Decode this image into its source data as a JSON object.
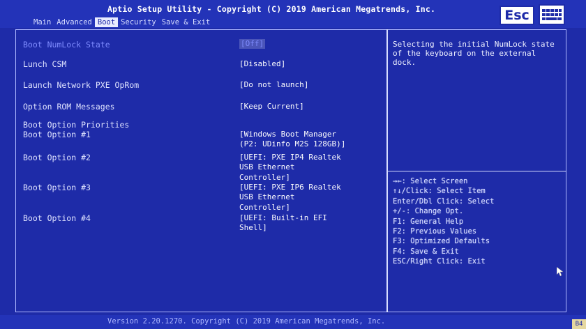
{
  "title": "Aptio Setup Utility - Copyright (C) 2019 American Megatrends, Inc.",
  "tabs": [
    {
      "label": "Main",
      "active": false
    },
    {
      "label": "Advanced",
      "active": false
    },
    {
      "label": "Boot",
      "active": true
    },
    {
      "label": "Security",
      "active": false
    },
    {
      "label": "Save & Exit",
      "active": false
    }
  ],
  "esc_label": "Esc",
  "icons": {
    "keyboard": "keyboard-icon",
    "cursor": "mouse-pointer-icon"
  },
  "settings": [
    {
      "label": "Boot NumLock State",
      "value": "[Off]",
      "selected": true
    },
    {
      "label": "Lunch CSM",
      "value": "[Disabled]",
      "selected": false
    },
    {
      "label": "Launch Network PXE OpRom",
      "value": "[Do not launch]",
      "selected": false
    },
    {
      "label": "Option ROM Messages",
      "value": "[Keep Current]",
      "selected": false
    }
  ],
  "section_header": "Boot Option Priorities",
  "boot_options": [
    {
      "label": "Boot Option #1",
      "value_lines": [
        "[Windows Boot Manager",
        "(P2: UDinfo M2S 128GB)]"
      ]
    },
    {
      "label": "Boot Option #2",
      "value_lines": [
        "[UEFI: PXE IP4 Realtek",
        "USB Ethernet",
        "Controller]"
      ]
    },
    {
      "label": "Boot Option #3",
      "value_lines": [
        "[UEFI: PXE IP6 Realtek",
        "USB Ethernet",
        "Controller]"
      ]
    },
    {
      "label": "Boot Option #4",
      "value_lines": [
        "[UEFI: Built-in EFI",
        "Shell]"
      ]
    }
  ],
  "help": {
    "description": "Selecting the initial NumLock state of the keyboard on the external dock.",
    "keys": [
      "→←: Select Screen",
      "↑↓/Click: Select Item",
      "Enter/Dbl Click: Select",
      "+/-: Change Opt.",
      "F1: General Help",
      "F2: Previous Values",
      "F3: Optimized Defaults",
      "F4: Save & Exit",
      "ESC/Right Click: Exit"
    ]
  },
  "footer": "Version 2.20.1270. Copyright (C) 2019 American Megatrends, Inc.",
  "corner_tag": "B4",
  "colors": {
    "background": "#1e2ba8",
    "text": "#dfe3ff",
    "highlight": "#7f8cff",
    "tab_active_bg": "#e9ecff"
  }
}
